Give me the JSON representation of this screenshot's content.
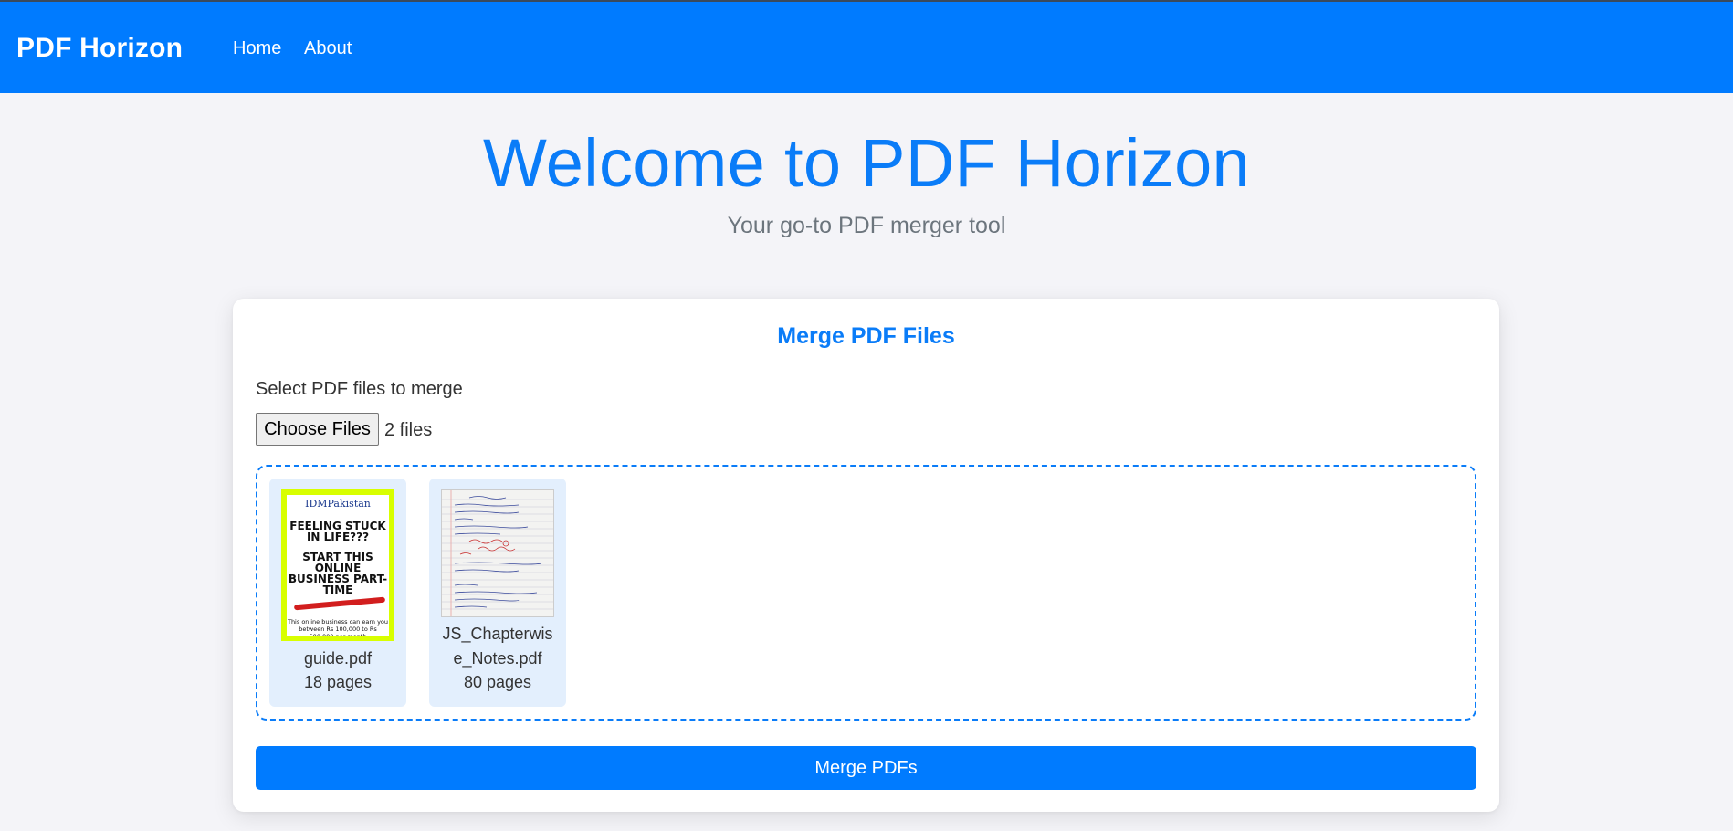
{
  "navbar": {
    "brand": "PDF Horizon",
    "links": [
      "Home",
      "About"
    ]
  },
  "hero": {
    "title": "Welcome to PDF Horizon",
    "subtitle": "Your go-to PDF merger tool"
  },
  "card": {
    "title": "Merge PDF Files",
    "select_label": "Select PDF files to merge",
    "file_button_label": "Choose Files",
    "file_count": "2 files",
    "files": [
      {
        "name_line1": "guide.pdf",
        "pages": "18 pages",
        "preview": {
          "brand": "IDMPakistan",
          "headline1": "FEELING STUCK IN LIFE???",
          "headline2": "START THIS ONLINE BUSINESS PART-TIME",
          "footer": "This online business can earn you between Rs 100,000 to Rs 500,000 per month"
        }
      },
      {
        "name_line1": "JS_Chapterwis",
        "name_line2": "e_Notes.pdf",
        "pages": "80 pages"
      }
    ],
    "merge_button_label": "Merge PDFs"
  },
  "colors": {
    "primary": "#007bff",
    "heading": "#0a7cf8",
    "thumb_bg": "#e3effd",
    "preview_border": "#d8ff00"
  }
}
